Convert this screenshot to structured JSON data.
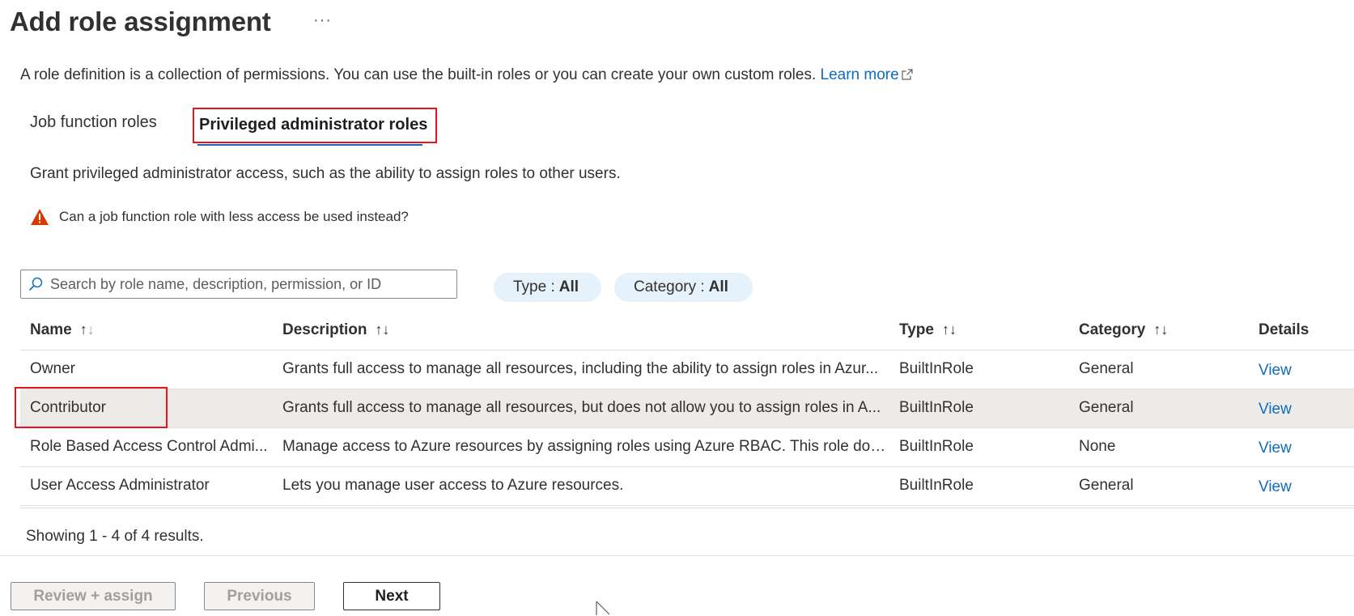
{
  "header": {
    "title": "Add role assignment",
    "more": "···"
  },
  "intro": {
    "text": "A role definition is a collection of permissions. You can use the built-in roles or you can create your own custom roles.",
    "link": "Learn more"
  },
  "tabs": [
    {
      "label": "Job function roles",
      "selected": false
    },
    {
      "label": "Privileged administrator roles",
      "selected": true
    }
  ],
  "grant_text": "Grant privileged administrator access, such as the ability to assign roles to other users.",
  "warning": "Can a job function role with less access be used instead?",
  "search": {
    "placeholder": "Search by role name, description, permission, or ID",
    "value": ""
  },
  "filters": {
    "type": {
      "label": "Type :",
      "value": "All"
    },
    "category": {
      "label": "Category :",
      "value": "All"
    }
  },
  "table": {
    "columns": [
      "Name",
      "Description",
      "Type",
      "Category",
      "Details"
    ],
    "rows": [
      {
        "name": "Owner",
        "description": "Grants full access to manage all resources, including the ability to assign roles in Azur...",
        "type": "BuiltInRole",
        "category": "General",
        "details": "View"
      },
      {
        "name": "Contributor",
        "description": "Grants full access to manage all resources, but does not allow you to assign roles in A...",
        "type": "BuiltInRole",
        "category": "General",
        "details": "View"
      },
      {
        "name": "Role Based Access Control Admi...",
        "description": "Manage access to Azure resources by assigning roles using Azure RBAC. This role doe...",
        "type": "BuiltInRole",
        "category": "None",
        "details": "View"
      },
      {
        "name": "User Access Administrator",
        "description": "Lets you manage user access to Azure resources.",
        "type": "BuiltInRole",
        "category": "General",
        "details": "View"
      }
    ]
  },
  "showing": "Showing 1 - 4 of 4 results.",
  "buttons": {
    "review": "Review + assign",
    "previous": "Previous",
    "next": "Next"
  },
  "colors": {
    "accent": "#0f6cbd",
    "highlight_box": "#e5131b",
    "warning": "#d83b01",
    "pill_bg": "#e6f2fb",
    "selected_row": "#edebe9"
  },
  "icons": {
    "search": "search-icon",
    "warning": "warning-icon",
    "external": "external-link-icon",
    "more": "more-icon"
  }
}
